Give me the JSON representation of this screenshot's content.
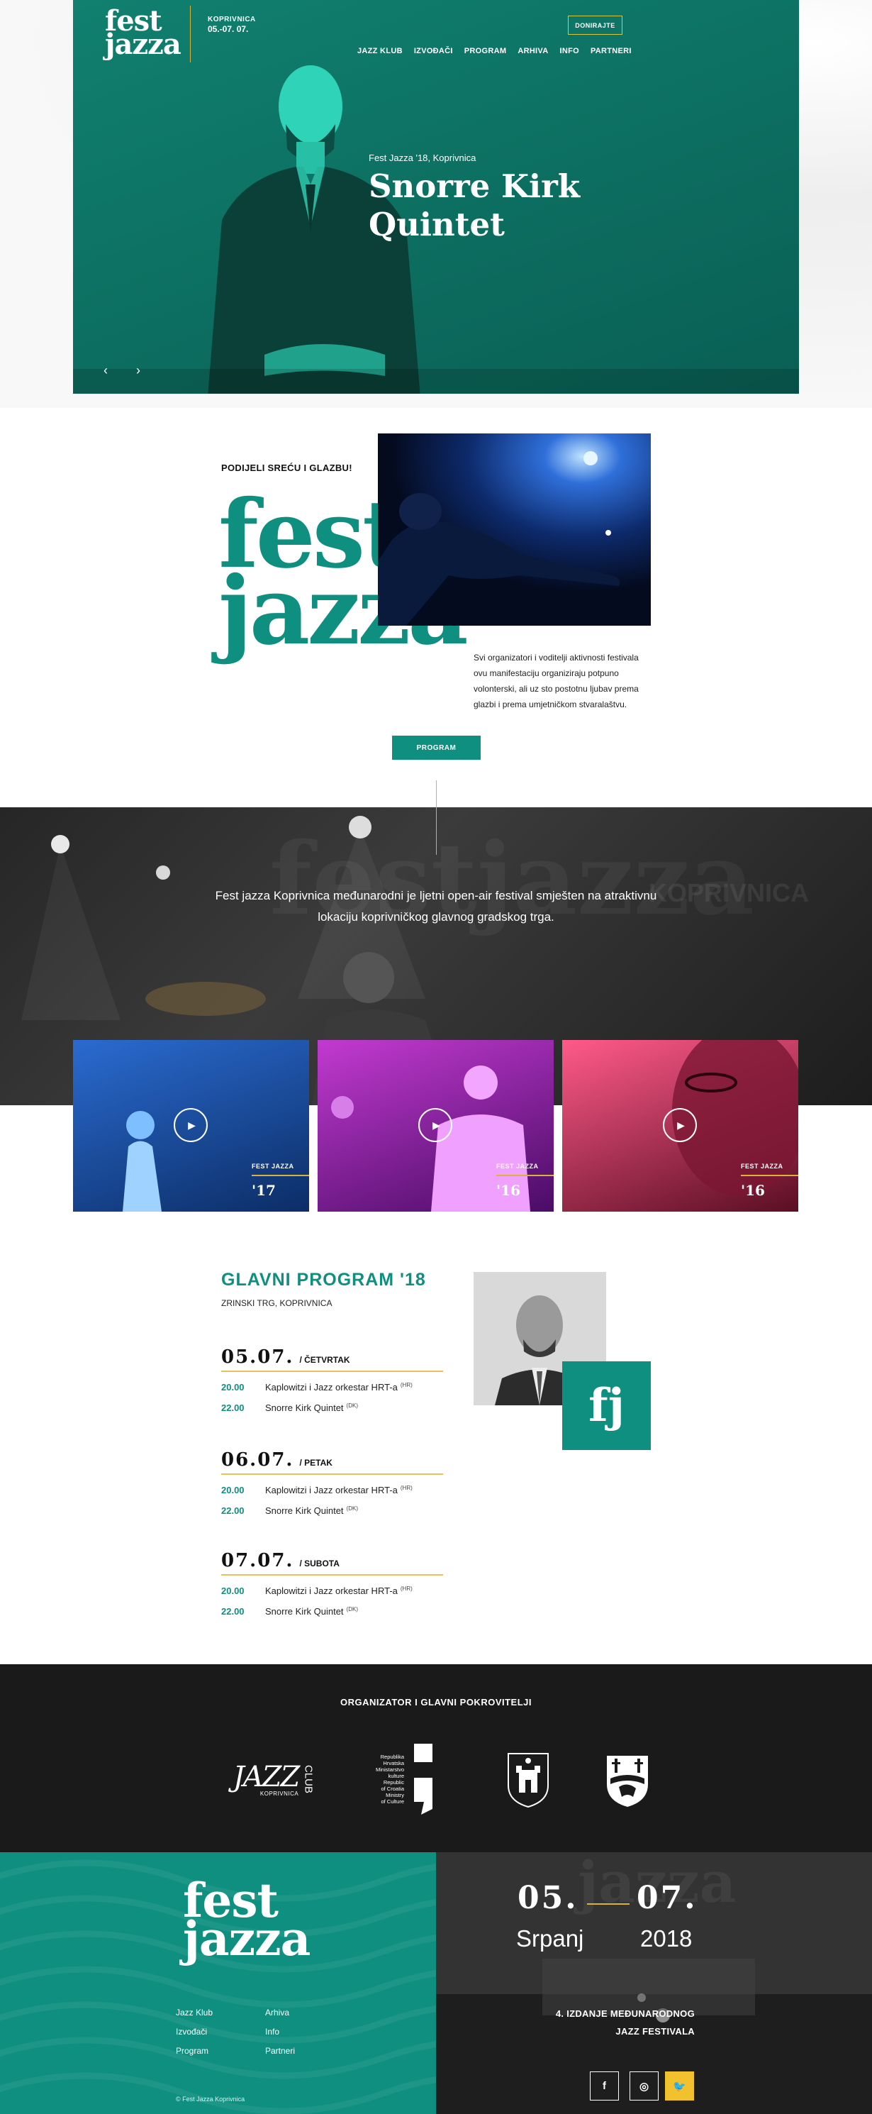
{
  "hero": {
    "logo_line1": "fest",
    "logo_line2": "jazza",
    "city": "KOPRIVNICA",
    "dates": "05.-07. 07.",
    "donate_label": "DONIRAJTE",
    "nav": [
      "JAZZ KLUB",
      "IZVOĐAČI",
      "PROGRAM",
      "ARHIVA",
      "INFO",
      "PARTNERI"
    ],
    "kicker": "Fest Jazza '18, Koprivnica",
    "title_line1": "Snorre Kirk",
    "title_line2": "Quintet",
    "prev_icon": "chevron-left-icon",
    "next_icon": "chevron-right-icon"
  },
  "share": {
    "heading": "PODIJELI SREĆU I GLAZBU!",
    "logo_line1": "fest",
    "logo_line2": "jazza",
    "text": "Svi organizatori i voditelji aktivnosti festivala ovu manifestaciju organiziraju potpuno volonterski, ali uz sto postotnu ljubav prema glazbi i prema umjetničkom stvaralaštvu.",
    "button": "PROGRAM"
  },
  "festival": {
    "description": "Fest jazza Koprivnica međunarodni je ljetni open-air festival smješten na atraktivnu lokaciju koprivničkog glavnog gradskog trga."
  },
  "videos": [
    {
      "label": "FEST JAZZA",
      "year": "'17",
      "tint": "#1a4f9c"
    },
    {
      "label": "FEST JAZZA",
      "year": "'16",
      "tint": "#9a1ea8"
    },
    {
      "label": "FEST JAZZA",
      "year": "'16",
      "tint": "#d92a5a"
    }
  ],
  "program": {
    "title": "GLAVNI PROGRAM '18",
    "location": "ZRINSKI TRG, KOPRIVNICA",
    "badge": "fj",
    "days": [
      {
        "date": "05.07.",
        "name": "/ ČETVRTAK",
        "events": [
          {
            "time": "20.00",
            "act": "Kaplowitzi i Jazz orkestar HRT-a",
            "cc": "(HR)"
          },
          {
            "time": "22.00",
            "act": "Snorre Kirk Quintet",
            "cc": "(DK)"
          }
        ]
      },
      {
        "date": "06.07.",
        "name": "/ PETAK",
        "events": [
          {
            "time": "20.00",
            "act": "Kaplowitzi i Jazz orkestar HRT-a",
            "cc": "(HR)"
          },
          {
            "time": "22.00",
            "act": "Snorre Kirk Quintet",
            "cc": "(DK)"
          }
        ]
      },
      {
        "date": "07.07.",
        "name": "/ SUBOTA",
        "events": [
          {
            "time": "20.00",
            "act": "Kaplowitzi i Jazz orkestar HRT-a",
            "cc": "(HR)"
          },
          {
            "time": "22.00",
            "act": "Snorre Kirk Quintet",
            "cc": "(DK)"
          }
        ]
      }
    ]
  },
  "sponsors": {
    "title": "ORGANIZATOR I GLAVNI POKROVITELJI",
    "jazz_club_main": "JAZZ",
    "jazz_club_side": "CLUB",
    "jazz_club_city": "KOPRIVNICA",
    "ministry_lines": [
      "Republika",
      "Hrvatska",
      "Ministarstvo",
      "kulture",
      "Republic",
      "of Croatia",
      "Ministry",
      "of Culture"
    ]
  },
  "footer": {
    "logo_line1": "fest",
    "logo_line2": "jazza",
    "links_col1": [
      "Jazz Klub",
      "Izvođači",
      "Program"
    ],
    "links_col2": [
      "Arhiva",
      "Info",
      "Partneri"
    ],
    "copyright": "© Fest Jazza Koprivnica",
    "date_start": "05.",
    "date_end": "07.",
    "month": "Srpanj",
    "year": "2018",
    "edition_line1": "4. IZDANJE MEĐUNARODNOG",
    "edition_line2": "JAZZ FESTIVALA",
    "social": [
      {
        "icon": "facebook-icon",
        "glyph": "f"
      },
      {
        "icon": "instagram-icon",
        "glyph": "◎"
      },
      {
        "icon": "twitter-icon",
        "glyph": "🐦"
      }
    ]
  }
}
